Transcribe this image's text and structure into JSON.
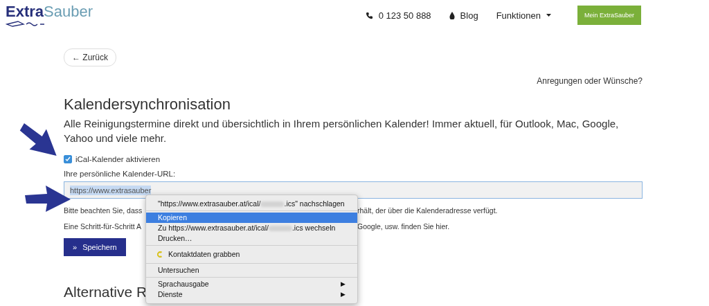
{
  "logo": {
    "part_1": "Extra",
    "part_2": "Sauber"
  },
  "nav": {
    "phone": "0 123 50 888",
    "blog": "Blog",
    "menu": "Funktionen",
    "account_button": "Mein ExtraSauber"
  },
  "back_button": "← Zurück",
  "feedback_link": "Anregungen oder Wünsche?",
  "heading": "Kalendersynchronisation",
  "intro": "Alle Reinigungstermine direkt und übersichtlich in Ihrem persönlichen Kalender! Immer aktuell, für Outlook, Mac, Google, Yahoo und viele mehr.",
  "checkbox": {
    "label": "iCal-Kalender aktivieren",
    "checked": true
  },
  "url_field": {
    "label": "Ihre persönliche Kalender-URL:",
    "value": "https://www.extrasauber",
    "highlighted": true
  },
  "notes": [
    {
      "left": "Bitte beachten Sie, dass",
      "right": "rhält, der über die Kalenderadresse verfügt."
    },
    {
      "left": "Eine Schritt-für-Schritt A",
      "right": "Google, usw. finden Sie hier."
    }
  ],
  "save_button": {
    "icon": "»",
    "label": "Speichern"
  },
  "subheading": "Alternative R",
  "context_menu": {
    "groups": [
      [
        {
          "kind": "blurred",
          "before": "\"https://www.extrasauber.at/ical/",
          "after": ".ics\" nachschlagen",
          "selected": false
        }
      ],
      [
        {
          "kind": "text",
          "label": "Kopieren",
          "selected": true
        },
        {
          "kind": "blurred",
          "before": "Zu https://www.extrasauber.at/ical/",
          "after": ".ics wechseln",
          "selected": false
        },
        {
          "kind": "text",
          "label": "Drucken…",
          "selected": false
        }
      ],
      [
        {
          "kind": "icon",
          "label": "Kontaktdaten grabben",
          "selected": false
        }
      ],
      [
        {
          "kind": "text",
          "label": "Untersuchen",
          "selected": false
        }
      ],
      [
        {
          "kind": "submenu",
          "label": "Sprachausgabe",
          "arrow": "▶",
          "selected": false
        },
        {
          "kind": "submenu",
          "label": "Dienste",
          "arrow": "▶",
          "selected": false
        }
      ]
    ]
  }
}
